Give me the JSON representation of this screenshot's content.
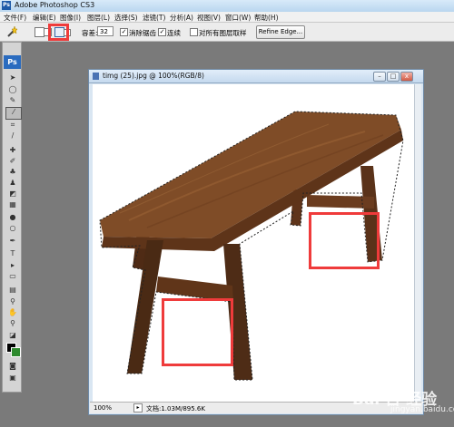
{
  "window": {
    "title": "Adobe Photoshop CS3"
  },
  "menu": {
    "items": [
      "文件(F)",
      "编辑(E)",
      "图像(I)",
      "图层(L)",
      "选择(S)",
      "滤镜(T)",
      "分析(A)",
      "视图(V)",
      "窗口(W)",
      "帮助(H)"
    ]
  },
  "options": {
    "tolerance_label": "容差:",
    "tolerance_value": "32",
    "antialias_label": "消除锯齿",
    "contiguous_label": "连续",
    "sample_all_label": "对所有图层取样",
    "refine_edge_label": "Refine Edge...",
    "colors": {
      "highlight": "#ef3b3b"
    }
  },
  "tools": {
    "logo": "Ps",
    "foreground_color": "#000000",
    "background_color": "#3a8a2a"
  },
  "document": {
    "title": "timg (25).jpg @ 100%(RGB/8)",
    "zoom": "100%",
    "doc_size": "文档:1.03M/895.6K",
    "image_description_colors": {
      "wood_dark": "#4a2a14",
      "wood_mid": "#7a4a26",
      "wood_light": "#9a6236"
    }
  },
  "watermark": {
    "main": "Bai 百 经验",
    "sub": "jingyan.baidu.com"
  }
}
